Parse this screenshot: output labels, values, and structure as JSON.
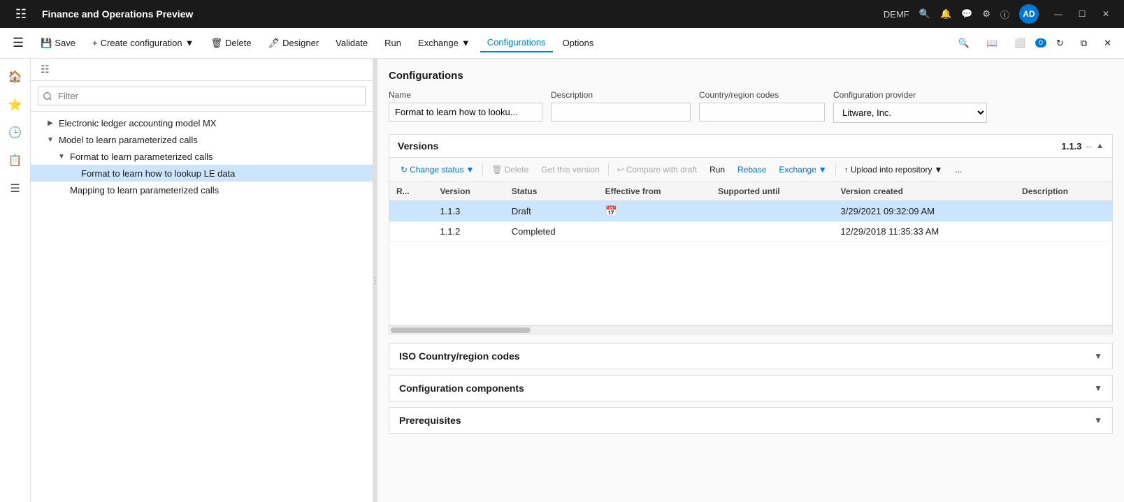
{
  "titleBar": {
    "title": "Finance and Operations Preview",
    "user": "DEMF",
    "avatar": "AD"
  },
  "toolbar": {
    "save": "Save",
    "createConfiguration": "Create configuration",
    "delete": "Delete",
    "designer": "Designer",
    "validate": "Validate",
    "run": "Run",
    "exchange": "Exchange",
    "configurations": "Configurations",
    "options": "Options"
  },
  "filterPlaceholder": "Filter",
  "tree": {
    "items": [
      {
        "id": "1",
        "label": "Electronic ledger accounting model MX",
        "indent": 1,
        "expanded": false,
        "selected": false
      },
      {
        "id": "2",
        "label": "Model to learn parameterized calls",
        "indent": 1,
        "expanded": true,
        "selected": false
      },
      {
        "id": "3",
        "label": "Format to learn parameterized calls",
        "indent": 2,
        "expanded": true,
        "selected": false
      },
      {
        "id": "4",
        "label": "Format to learn how to lookup LE data",
        "indent": 3,
        "expanded": false,
        "selected": true
      },
      {
        "id": "5",
        "label": "Mapping to learn parameterized calls",
        "indent": 2,
        "expanded": false,
        "selected": false
      }
    ]
  },
  "configurationsSection": {
    "title": "Configurations",
    "fields": {
      "name": {
        "label": "Name",
        "value": "Format to learn how to looku..."
      },
      "description": {
        "label": "Description",
        "value": ""
      },
      "countryRegion": {
        "label": "Country/region codes",
        "value": ""
      },
      "configProvider": {
        "label": "Configuration provider",
        "value": "Litware, Inc."
      }
    }
  },
  "versionsSection": {
    "title": "Versions",
    "currentVersion": "1.1.3",
    "dash": "--",
    "toolbar": {
      "changeStatus": "Change status",
      "delete": "Delete",
      "getThisVersion": "Get this version",
      "compareWithDraft": "Compare with draft",
      "run": "Run",
      "rebase": "Rebase",
      "exchange": "Exchange",
      "uploadIntoRepository": "Upload into repository",
      "moreOptions": "..."
    },
    "columns": [
      "R...",
      "Version",
      "Status",
      "Effective from",
      "Supported until",
      "Version created",
      "Description"
    ],
    "rows": [
      {
        "r": "",
        "version": "1.1.3",
        "status": "Draft",
        "effectiveFrom": "",
        "hasCalIcon": true,
        "supportedUntil": "",
        "versionCreated": "3/29/2021 09:32:09 AM",
        "description": "",
        "selected": true
      },
      {
        "r": "",
        "version": "1.1.2",
        "status": "Completed",
        "effectiveFrom": "",
        "hasCalIcon": false,
        "supportedUntil": "",
        "versionCreated": "12/29/2018 11:35:33 AM",
        "description": "",
        "selected": false
      }
    ]
  },
  "collapsibleSections": [
    {
      "id": "iso",
      "label": "ISO Country/region codes",
      "expanded": false
    },
    {
      "id": "components",
      "label": "Configuration components",
      "expanded": false
    },
    {
      "id": "prerequisites",
      "label": "Prerequisites",
      "expanded": false
    }
  ]
}
